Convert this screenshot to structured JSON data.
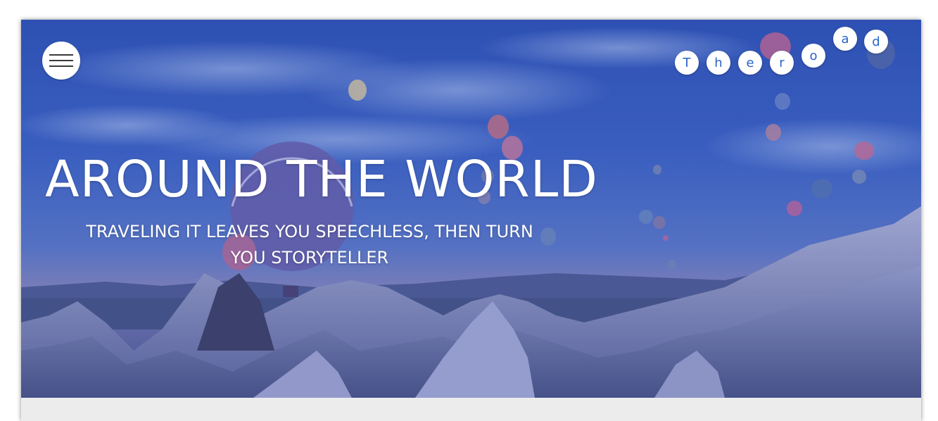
{
  "header": {
    "menu_icon": "hamburger-icon",
    "logo_letters": [
      "T",
      "h",
      "e",
      "r",
      "o",
      "a",
      "d"
    ]
  },
  "hero": {
    "title": "AROUND THE WORLD",
    "subtitle": "TRAVELING IT LEAVES YOU SPEECHLESS, THEN TURN YOU STORYTELLER",
    "background": "hot-air-balloons-over-valley-photo"
  },
  "colors": {
    "overlay": "#3657b8",
    "logo_text": "#2a63c7",
    "content_bg": "#ececec"
  }
}
